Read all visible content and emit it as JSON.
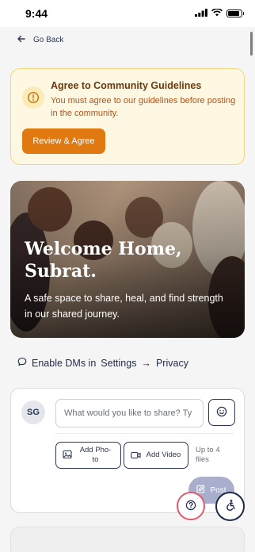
{
  "status_bar": {
    "time": "9:44"
  },
  "nav": {
    "back_label": "Go Back"
  },
  "guidelines": {
    "title": "Agree to Community Guidelines",
    "text": "You must agree to our guidelines before posting in the community.",
    "button_label": "Review & Agree"
  },
  "hero": {
    "title": "Welcome Home, Subrat.",
    "subtitle": "A safe space to share, heal, and find strength in our shared journey."
  },
  "dm_hint": {
    "prefix": "Enable DMs in",
    "settings": "Settings",
    "arrow": "→",
    "privacy": "Privacy"
  },
  "composer": {
    "avatar_initials": "SG",
    "placeholder": "What would you like to share? Ty",
    "add_photo_label": "Add Pho-to",
    "add_video_label": "Add Video",
    "limit_text": "Up to 4 files",
    "post_label": "Post"
  },
  "colors": {
    "accent": "#e07a10",
    "navy": "#1e2a4a",
    "warning_bg": "#fef7e2",
    "help_ring": "#e05a6d",
    "post_disabled": "#a9aecd"
  },
  "icons": {
    "back": "arrow-left-icon",
    "alert": "alert-circle-icon",
    "dm": "chat-bubble-icon",
    "emoji": "smile-icon",
    "photo": "image-icon",
    "video": "video-icon",
    "post": "edit-icon",
    "help": "question-icon",
    "accessibility": "accessibility-icon"
  }
}
